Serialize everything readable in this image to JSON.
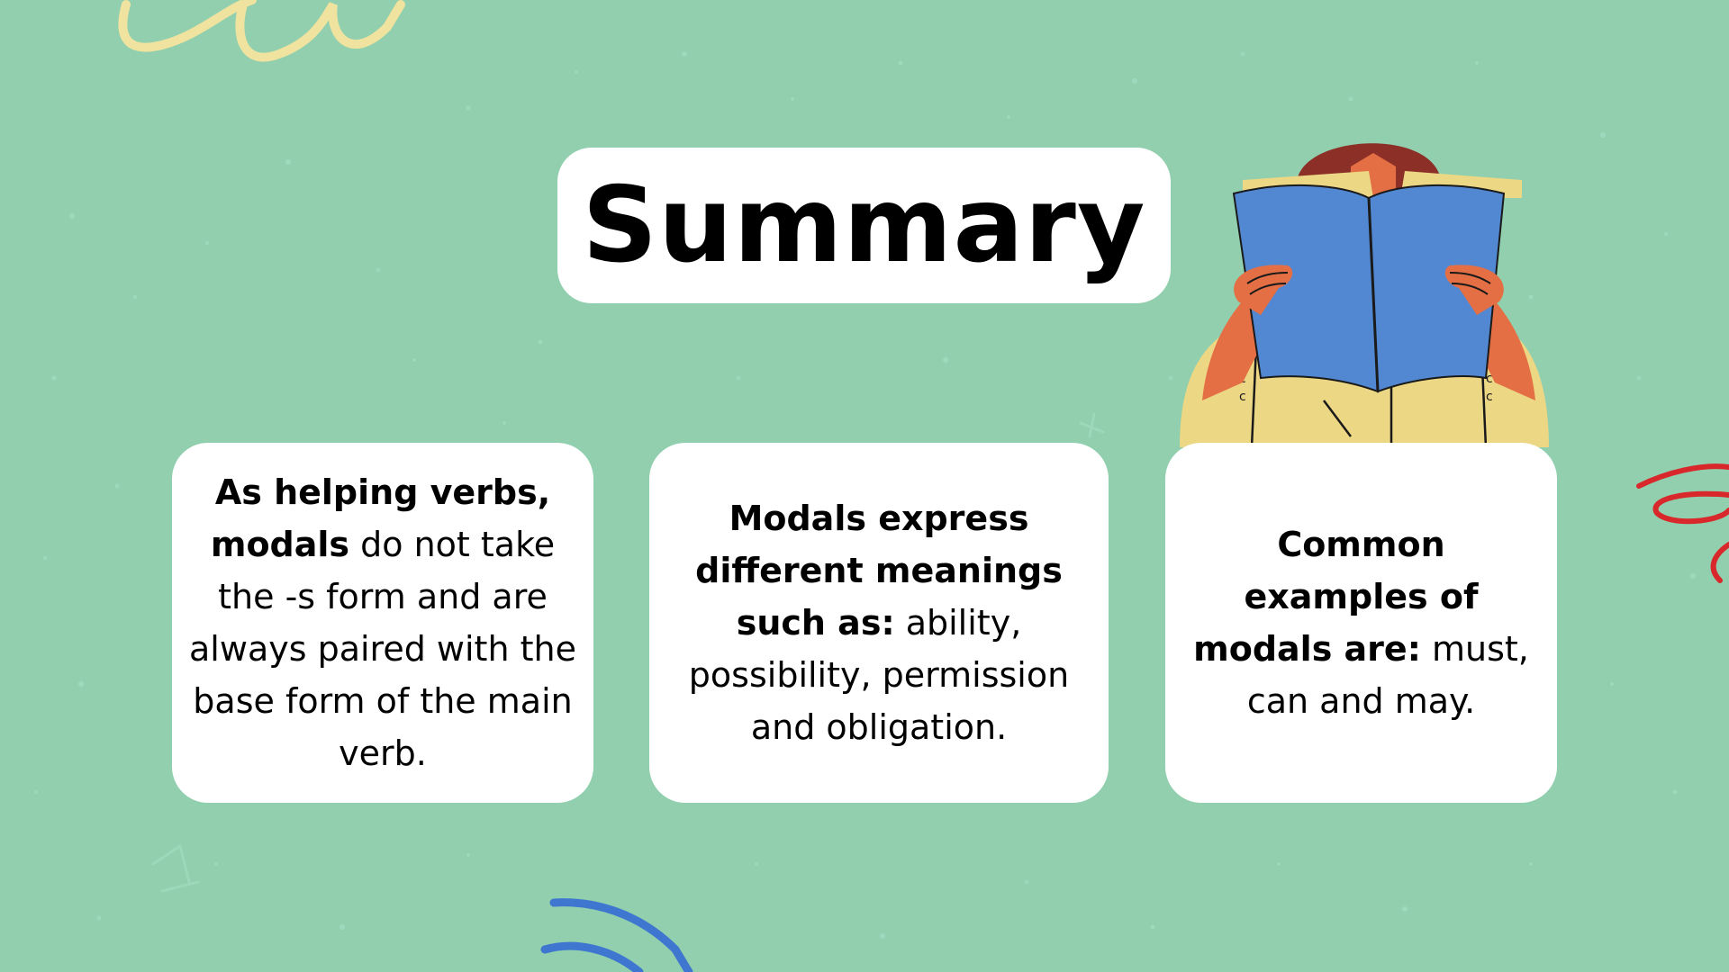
{
  "title": "Summary",
  "cards": [
    {
      "parts": [
        {
          "text": "As helping verbs, modals",
          "bold": true
        },
        {
          "text": " do not take the -s form and are always paired with the base form of the main verb.",
          "bold": false
        }
      ]
    },
    {
      "parts": [
        {
          "text": "Modals express different meanings such as:",
          "bold": true
        },
        {
          "text": " ability, possibility, permission and obligation.",
          "bold": false
        }
      ]
    },
    {
      "parts": [
        {
          "text": "Common examples of modals are:",
          "bold": true
        },
        {
          "text": " must, can and may.",
          "bold": false
        }
      ]
    }
  ],
  "colors": {
    "background": "#91cfae",
    "card": "#ffffff",
    "text": "#000000",
    "book": "#5287d1",
    "hair": "#8b2f27",
    "skin": "#e46f45",
    "coat": "#ecd785",
    "scribble_yellow": "#f0e3a0",
    "scribble_red": "#d8282b",
    "scribble_blue": "#3f76cf"
  },
  "icons": {
    "illustration": "person-reading-book-icon"
  }
}
